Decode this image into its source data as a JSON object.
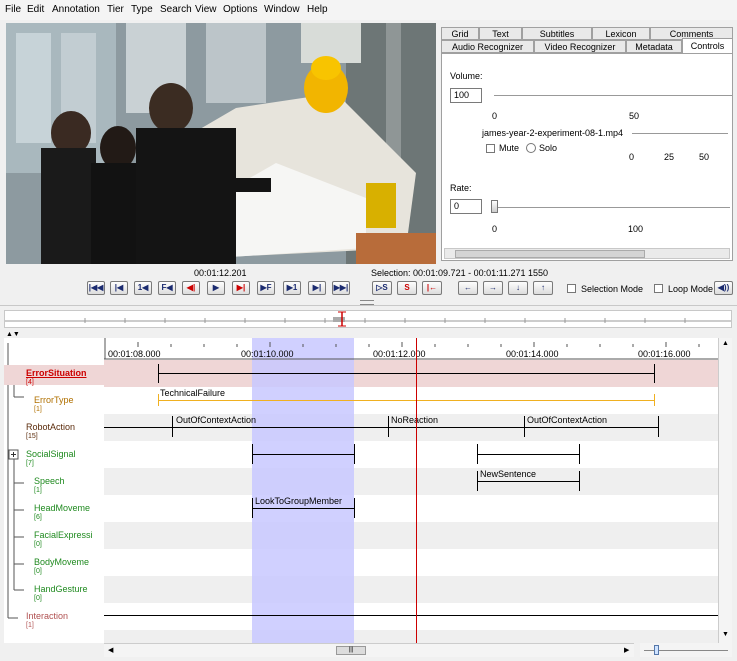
{
  "menu": [
    "File",
    "Edit",
    "Annotation",
    "Tier",
    "Type",
    "Search",
    "View",
    "Options",
    "Window",
    "Help"
  ],
  "tabs_top": [
    "Grid",
    "Text",
    "Subtitles",
    "Lexicon",
    "Comments"
  ],
  "tabs_bottom": [
    "Audio Recognizer",
    "Video Recognizer",
    "Metadata",
    "Controls"
  ],
  "controls": {
    "volume_label": "Volume:",
    "volume_value": "100",
    "volume_ticks": [
      "0",
      "50"
    ],
    "media_file": "james-year-2-experiment-08-1.mp4",
    "mute_label": "Mute",
    "solo_label": "Solo",
    "mute_ticks": [
      "0",
      "25",
      "50"
    ],
    "rate_label": "Rate:",
    "rate_value": "0",
    "rate_ticks": [
      "0",
      "100"
    ]
  },
  "player": {
    "current_time": "00:01:12.201",
    "selection": "Selection: 00:01:09.721 - 00:01:11.271  1550",
    "selection_mode_label": "Selection Mode",
    "loop_mode_label": "Loop Mode",
    "buttons": [
      "|◀◀",
      "|◀",
      "1◀",
      "F◀",
      "◀|",
      "▶",
      "▶|",
      "▶F",
      "▶1",
      "▶|",
      "▶▶|",
      "▷S",
      "S",
      "|←",
      "←",
      "→",
      "↓",
      "↑",
      "◀))"
    ]
  },
  "timeline": {
    "ruler_labels": [
      "00:01:08.000",
      "00:01:10.000",
      "00:01:12.000",
      "00:01:14.000",
      "00:01:16.000"
    ],
    "tiers": [
      {
        "name": "ErrorSituation",
        "count": "[4]",
        "color": "#cc0000"
      },
      {
        "name": "ErrorType",
        "count": "[1]",
        "color": "#b07000"
      },
      {
        "name": "RobotAction",
        "count": "[15]",
        "color": "#5a2a0a"
      },
      {
        "name": "SocialSignal",
        "count": "[7]",
        "color": "#1f8a1f"
      },
      {
        "name": "Speech",
        "count": "[1]",
        "color": "#1f8a1f"
      },
      {
        "name": "HeadMoveme",
        "count": "[6]",
        "color": "#1f8a1f"
      },
      {
        "name": "FacialExpressi",
        "count": "[0]",
        "color": "#1f8a1f"
      },
      {
        "name": "BodyMoveme",
        "count": "[0]",
        "color": "#1f8a1f"
      },
      {
        "name": "HandGesture",
        "count": "[0]",
        "color": "#1f8a1f"
      },
      {
        "name": "Interaction",
        "count": "[1]",
        "color": "#b05050"
      }
    ],
    "annotations": {
      "technical_failure": "TechnicalFailure",
      "out_of_context_1": "OutOfContextAction",
      "no_reaction": "NoReaction",
      "out_of_context_2": "OutOfContextAction",
      "new_sentence": "NewSentence",
      "look_to_group": "LookToGroupMember"
    }
  },
  "colors": {
    "selection": "#c8c8ff",
    "cursor": "#cc0000",
    "error_row": "#efd6d6",
    "error_type_line": "#f0b020"
  }
}
